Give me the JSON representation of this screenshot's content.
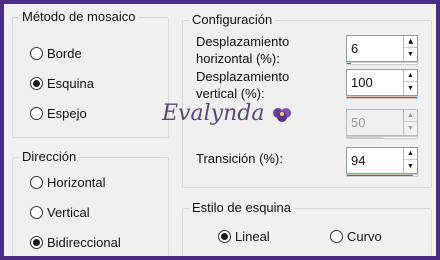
{
  "mosaic_method": {
    "title": "Método de mosaico",
    "options": [
      {
        "label": "Borde",
        "checked": false
      },
      {
        "label": "Esquina",
        "checked": true
      },
      {
        "label": "Espejo",
        "checked": false
      }
    ]
  },
  "direction": {
    "title": "Dirección",
    "options": [
      {
        "label": "Horizontal",
        "checked": false
      },
      {
        "label": "Vertical",
        "checked": false
      },
      {
        "label": "Bidireccional",
        "checked": true
      }
    ]
  },
  "configuration": {
    "title": "Configuración",
    "horizontal_offset_label_line1": "Desplazamiento",
    "horizontal_offset_label_line2": "horizontal (%):",
    "horizontal_offset_value": "6",
    "horizontal_offset_fill": 0.06,
    "vertical_offset_label_line1": "Desplazamiento",
    "vertical_offset_label_line2": "vertical (%):",
    "vertical_offset_value": "100",
    "vertical_offset_fill": 1.0,
    "disabled_value": "50",
    "disabled_fill": 0.5,
    "transition_label": "Transición (%):",
    "transition_value": "94",
    "transition_fill": 0.94
  },
  "corner_style": {
    "title": "Estilo de esquina",
    "options": [
      {
        "label": "Lineal",
        "checked": true
      },
      {
        "label": "Curvo",
        "checked": false
      }
    ]
  },
  "watermark": "Evalynda",
  "accent_color": "#1f78c8",
  "frame_color": "#4b2c83"
}
